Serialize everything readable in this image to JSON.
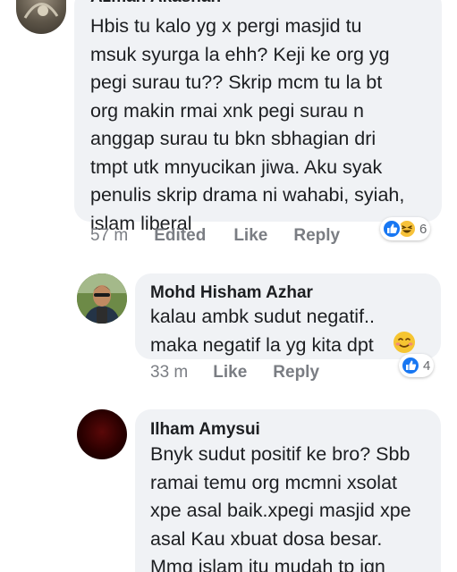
{
  "comments": [
    {
      "author": "Azman Akashah",
      "text": "Hbis tu kalo yg x pergi masjid tu\nmsuk syurga la ehh? Keji ke org yg\npegi surau tu?? Skrip mcm tu la bt\norg makin rmai xnk pegi surau n\nanggap surau tu bkn sbhagian dri\ntmpt utk mnyucikan jiwa. Aku syak\npenulis skrip drama ni wahabi, syiah,\nislam liberal",
      "time": "57 m",
      "edited": "Edited",
      "like": "Like",
      "reply": "Reply",
      "reaction_count": "6",
      "reactions": [
        "like-icon",
        "haha-icon"
      ]
    },
    {
      "author": "Mohd Hisham Azhar",
      "text": "kalau ambk sudut negatif..\nmaka negatif la yg kita dpt",
      "emoji": "smiling-face-emoji",
      "time": "33 m",
      "like": "Like",
      "reply": "Reply",
      "reaction_count": "4",
      "reactions": [
        "like-icon"
      ]
    },
    {
      "author": "Ilham Amysui",
      "text": "Bnyk sudut positif ke bro? Sbb\nramai temu org mcmni xsolat\nxpe asal baik.xpegi masjid xpe\nasal Kau xbuat dosa besar.\nMmg islam itu mudah tp jgn"
    }
  ],
  "colors": {
    "bubble": "#f0f2f5",
    "like_blue": "#1877f2",
    "haha_yellow": "#f7c23a",
    "meta_gray": "#7a7d83"
  }
}
